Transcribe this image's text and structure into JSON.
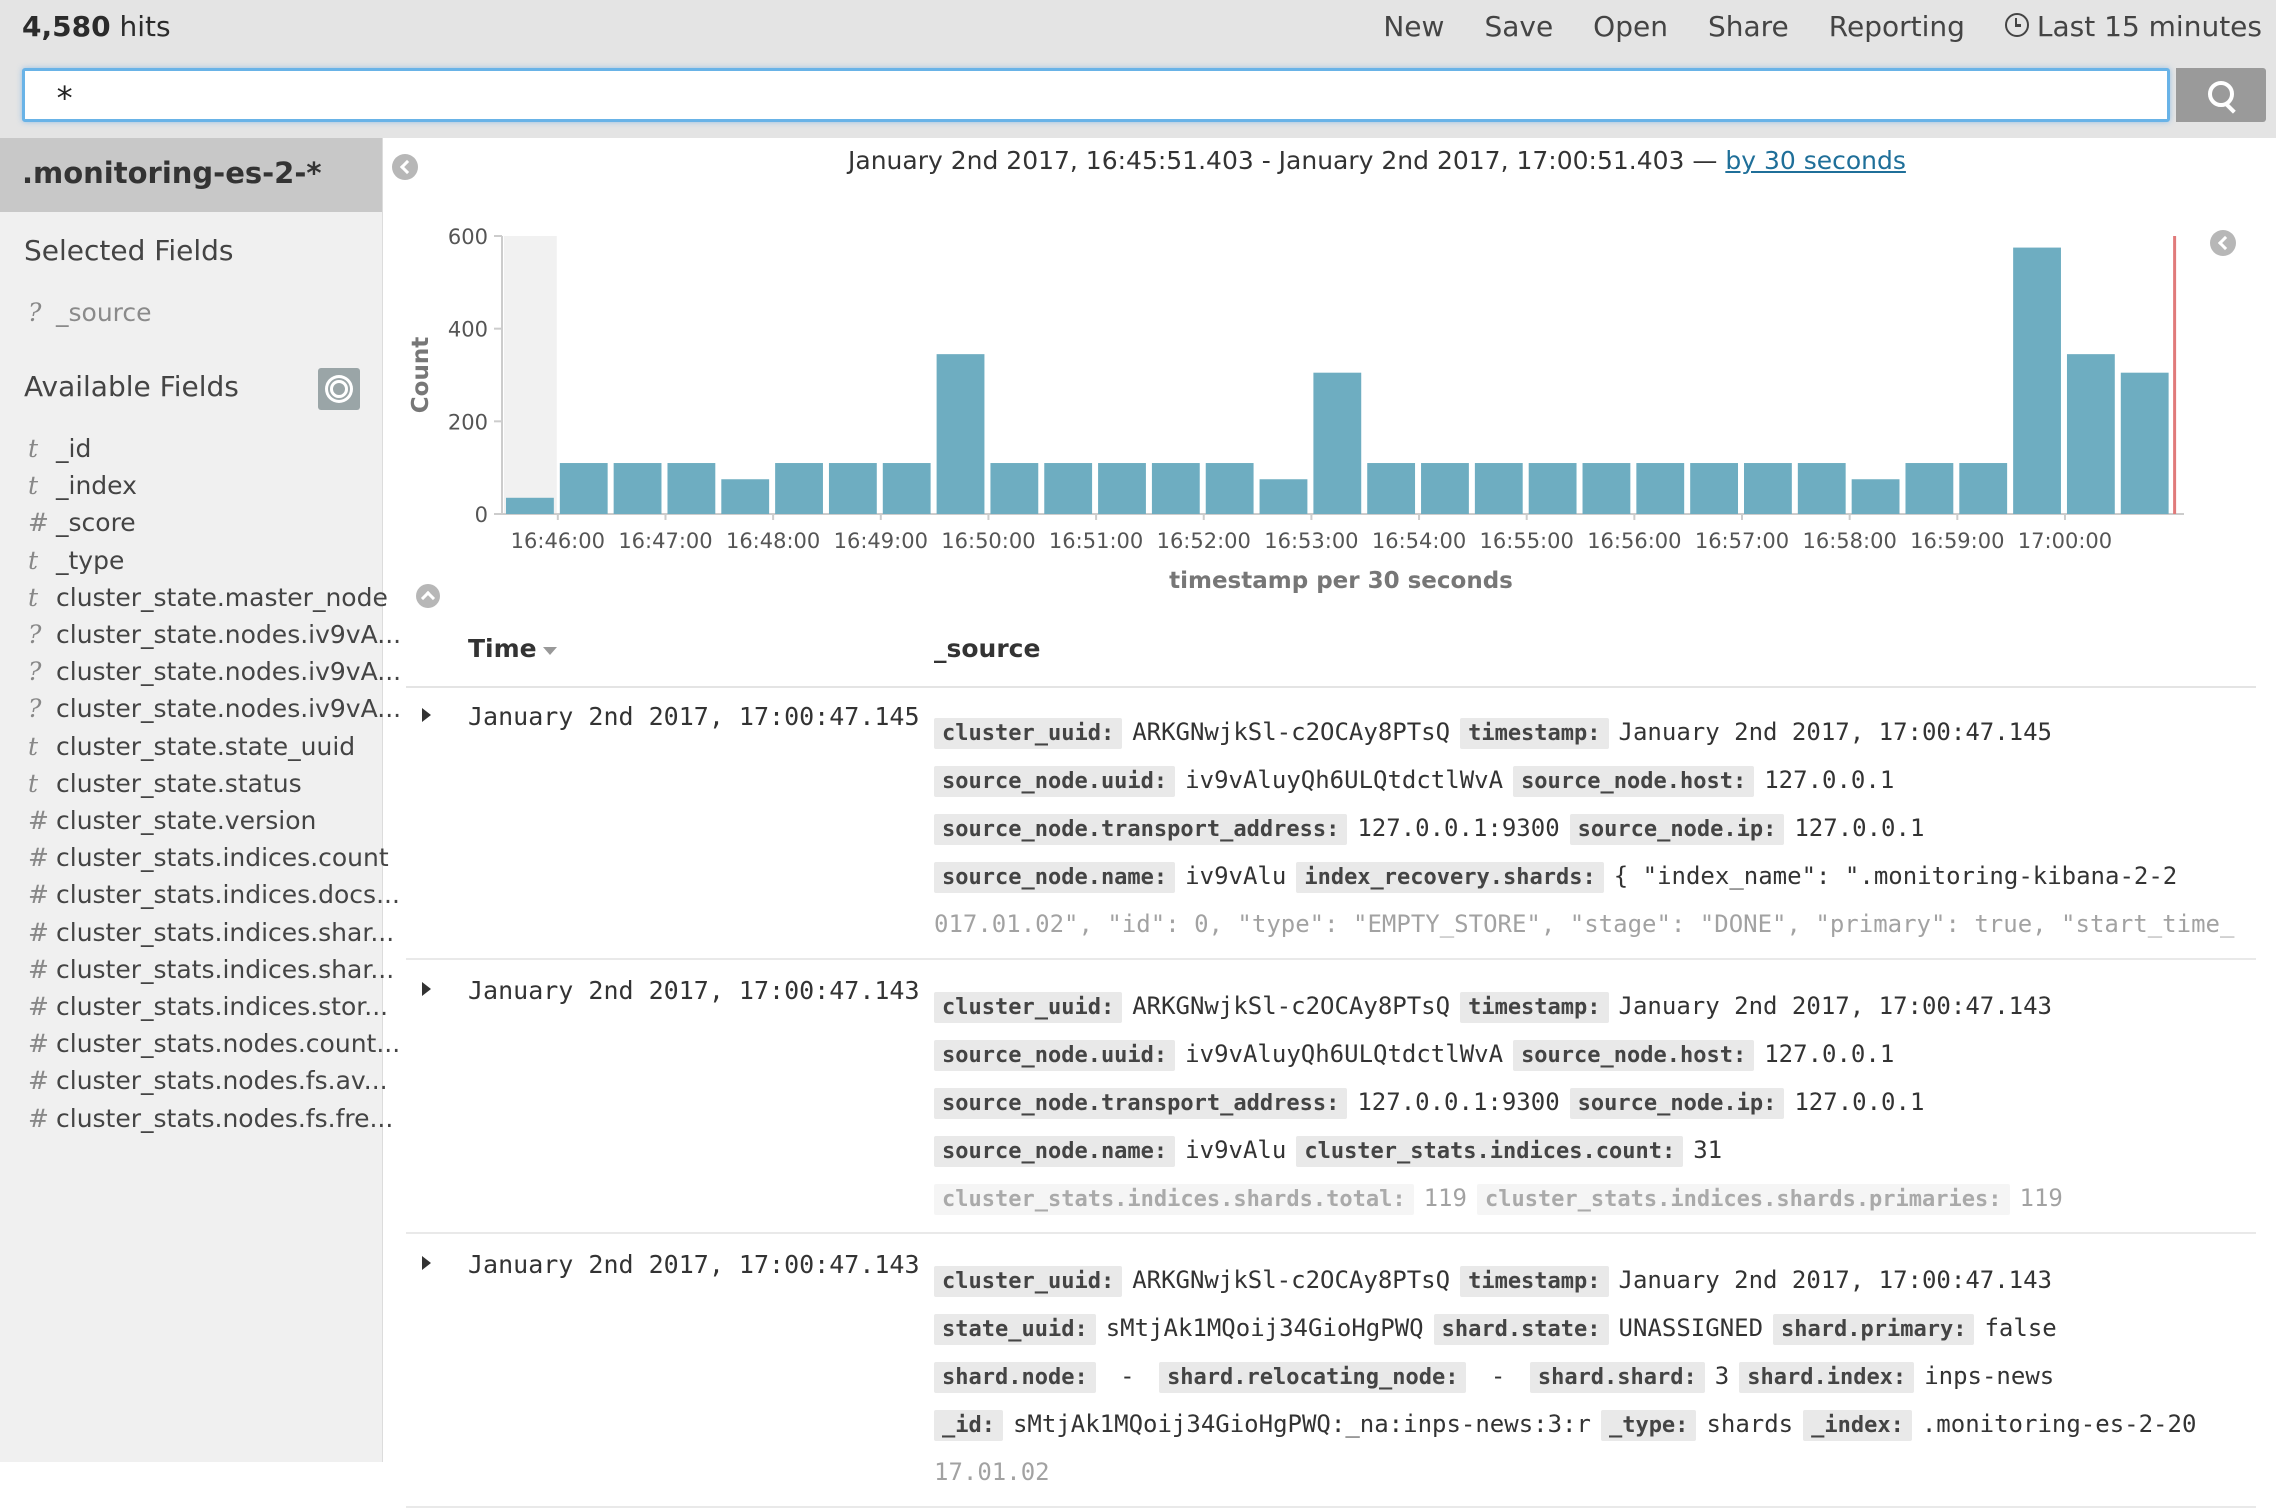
{
  "topbar": {
    "hits_count": "4,580",
    "hits_label": "hits",
    "menu": [
      "New",
      "Save",
      "Open",
      "Share",
      "Reporting"
    ],
    "time_picker": "Last 15 minutes"
  },
  "search": {
    "value": "*"
  },
  "sidebar": {
    "index_pattern": ".monitoring-es-2-*",
    "selected_heading": "Selected Fields",
    "selected_fields": [
      {
        "type": "?",
        "name": "_source"
      }
    ],
    "available_heading": "Available Fields",
    "available_fields": [
      {
        "type": "t",
        "name": "_id"
      },
      {
        "type": "t",
        "name": "_index"
      },
      {
        "type": "#",
        "name": "_score"
      },
      {
        "type": "t",
        "name": "_type"
      },
      {
        "type": "t",
        "name": "cluster_state.master_node"
      },
      {
        "type": "?",
        "name": "cluster_state.nodes.iv9vA..."
      },
      {
        "type": "?",
        "name": "cluster_state.nodes.iv9vA..."
      },
      {
        "type": "?",
        "name": "cluster_state.nodes.iv9vA..."
      },
      {
        "type": "t",
        "name": "cluster_state.state_uuid"
      },
      {
        "type": "t",
        "name": "cluster_state.status"
      },
      {
        "type": "#",
        "name": "cluster_state.version"
      },
      {
        "type": "#",
        "name": "cluster_stats.indices.count"
      },
      {
        "type": "#",
        "name": "cluster_stats.indices.docs..."
      },
      {
        "type": "#",
        "name": "cluster_stats.indices.shar..."
      },
      {
        "type": "#",
        "name": "cluster_stats.indices.shar..."
      },
      {
        "type": "#",
        "name": "cluster_stats.indices.stor..."
      },
      {
        "type": "#",
        "name": "cluster_stats.nodes.count..."
      },
      {
        "type": "#",
        "name": "cluster_stats.nodes.fs.av..."
      },
      {
        "type": "#",
        "name": "cluster_stats.nodes.fs.fre..."
      }
    ]
  },
  "range": {
    "text": "January 2nd 2017, 16:45:51.403 - January 2nd 2017, 17:00:51.403 —",
    "interval_link": "by 30 seconds"
  },
  "colors": {
    "bar": "#6eadc1",
    "accent_link": "#1f6f99",
    "now_line": "#e07a7a"
  },
  "chart_data": {
    "type": "bar",
    "ylabel": "Count",
    "xlabel": "timestamp per 30 seconds",
    "ylim": [
      0,
      600
    ],
    "yticks": [
      0,
      200,
      400,
      600
    ],
    "x_tick_labels": [
      "16:46:00",
      "16:47:00",
      "16:48:00",
      "16:49:00",
      "16:50:00",
      "16:51:00",
      "16:52:00",
      "16:53:00",
      "16:54:00",
      "16:55:00",
      "16:56:00",
      "16:57:00",
      "16:58:00",
      "16:59:00",
      "17:00:00"
    ],
    "values": [
      35,
      110,
      110,
      110,
      75,
      110,
      110,
      110,
      345,
      110,
      110,
      110,
      110,
      110,
      75,
      305,
      110,
      110,
      110,
      110,
      110,
      110,
      110,
      110,
      110,
      75,
      110,
      110,
      575,
      345,
      305
    ],
    "grid": false
  },
  "table": {
    "col_time": "Time",
    "col_source": "_source",
    "rows": [
      {
        "time": "January 2nd 2017, 17:00:47.145",
        "lines": [
          [
            [
              "cluster_uuid:",
              "ARKGNwjkSl-c2OCAy8PTsQ"
            ],
            [
              "timestamp:",
              "January 2nd 2017, 17:00:47.145"
            ]
          ],
          [
            [
              "source_node.uuid:",
              "iv9vAluyQh6ULQtdctlWvA"
            ],
            [
              "source_node.host:",
              "127.0.0.1"
            ]
          ],
          [
            [
              "source_node.transport_address:",
              "127.0.0.1:9300"
            ],
            [
              "source_node.ip:",
              "127.0.0.1"
            ]
          ],
          [
            [
              "source_node.name:",
              "iv9vAlu"
            ],
            [
              "index_recovery.shards:",
              "{ \"index_name\": \".monitoring-kibana-2-2"
            ]
          ]
        ],
        "fade_line": "017.01.02\", \"id\": 0, \"type\": \"EMPTY_STORE\", \"stage\": \"DONE\", \"primary\": true, \"start_time_"
      },
      {
        "time": "January 2nd 2017, 17:00:47.143",
        "lines": [
          [
            [
              "cluster_uuid:",
              "ARKGNwjkSl-c2OCAy8PTsQ"
            ],
            [
              "timestamp:",
              "January 2nd 2017, 17:00:47.143"
            ]
          ],
          [
            [
              "source_node.uuid:",
              "iv9vAluyQh6ULQtdctlWvA"
            ],
            [
              "source_node.host:",
              "127.0.0.1"
            ]
          ],
          [
            [
              "source_node.transport_address:",
              "127.0.0.1:9300"
            ],
            [
              "source_node.ip:",
              "127.0.0.1"
            ]
          ],
          [
            [
              "source_node.name:",
              "iv9vAlu"
            ],
            [
              "cluster_stats.indices.count:",
              "31"
            ]
          ],
          [
            [
              "cluster_stats.indices.shards.total:",
              "119"
            ],
            [
              "cluster_stats.indices.shards.primaries:",
              "119"
            ]
          ]
        ]
      },
      {
        "time": "January 2nd 2017, 17:00:47.143",
        "lines": [
          [
            [
              "cluster_uuid:",
              "ARKGNwjkSl-c2OCAy8PTsQ"
            ],
            [
              "timestamp:",
              "January 2nd 2017, 17:00:47.143"
            ]
          ],
          [
            [
              "state_uuid:",
              "sMtjAk1MQoij34GioHgPWQ"
            ],
            [
              "shard.state:",
              "UNASSIGNED"
            ],
            [
              "shard.primary:",
              "false"
            ]
          ],
          [
            [
              "shard.node:",
              " - "
            ],
            [
              "shard.relocating_node:",
              " - "
            ],
            [
              "shard.shard:",
              "3"
            ],
            [
              "shard.index:",
              "inps-news"
            ]
          ],
          [
            [
              "_id:",
              "sMtjAk1MQoij34GioHgPWQ:_na:inps-news:3:r"
            ],
            [
              "_type:",
              "shards"
            ],
            [
              "_index:",
              ".monitoring-es-2-20"
            ]
          ]
        ],
        "fade_line": "17.01.02"
      }
    ]
  }
}
